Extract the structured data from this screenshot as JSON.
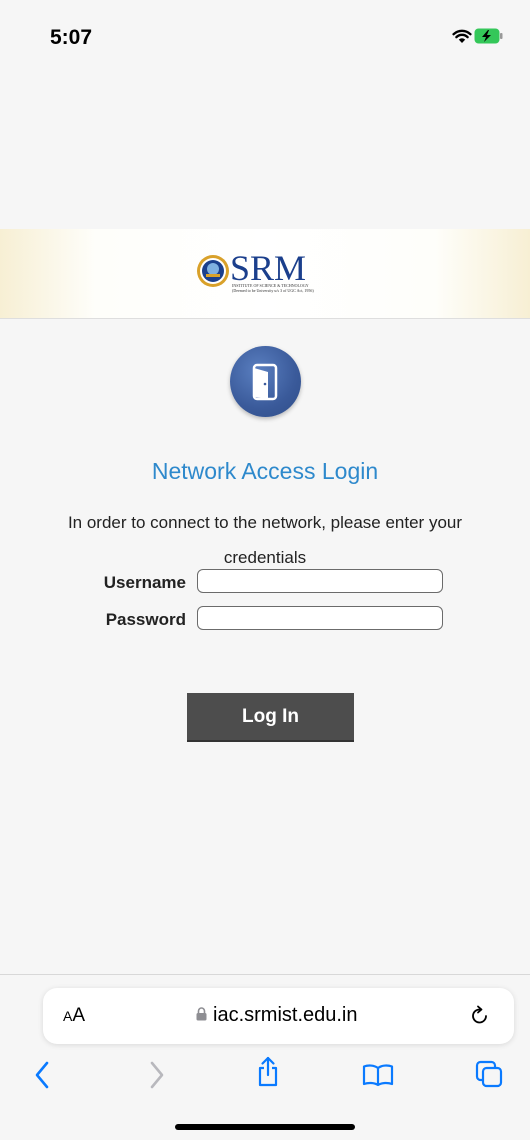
{
  "status_bar": {
    "time": "5:07"
  },
  "banner": {
    "logo_text": "SRM",
    "logo_subtitle_1": "INSTITUTE OF SCIENCE & TECHNOLOGY",
    "logo_subtitle_2": "(Deemed to be University u/s 3 of UGC Act, 1956)"
  },
  "login": {
    "title": "Network Access Login",
    "instructions": "In order to connect to the network, please enter your credentials",
    "username_label": "Username",
    "username_value": "",
    "password_label": "Password",
    "password_value": "",
    "button_label": "Log In"
  },
  "browser": {
    "text_size_small": "A",
    "text_size_big": "A",
    "url": "iac.srmist.edu.in",
    "icons": [
      "back-icon",
      "forward-icon",
      "share-icon",
      "bookmarks-icon",
      "tabs-icon",
      "reload-icon",
      "lock-icon"
    ]
  },
  "colors": {
    "title_blue": "#2e89cc",
    "logo_blue": "#1b3f8c",
    "button_bg": "#4d4d4d",
    "ios_blue": "#0a7aff"
  }
}
